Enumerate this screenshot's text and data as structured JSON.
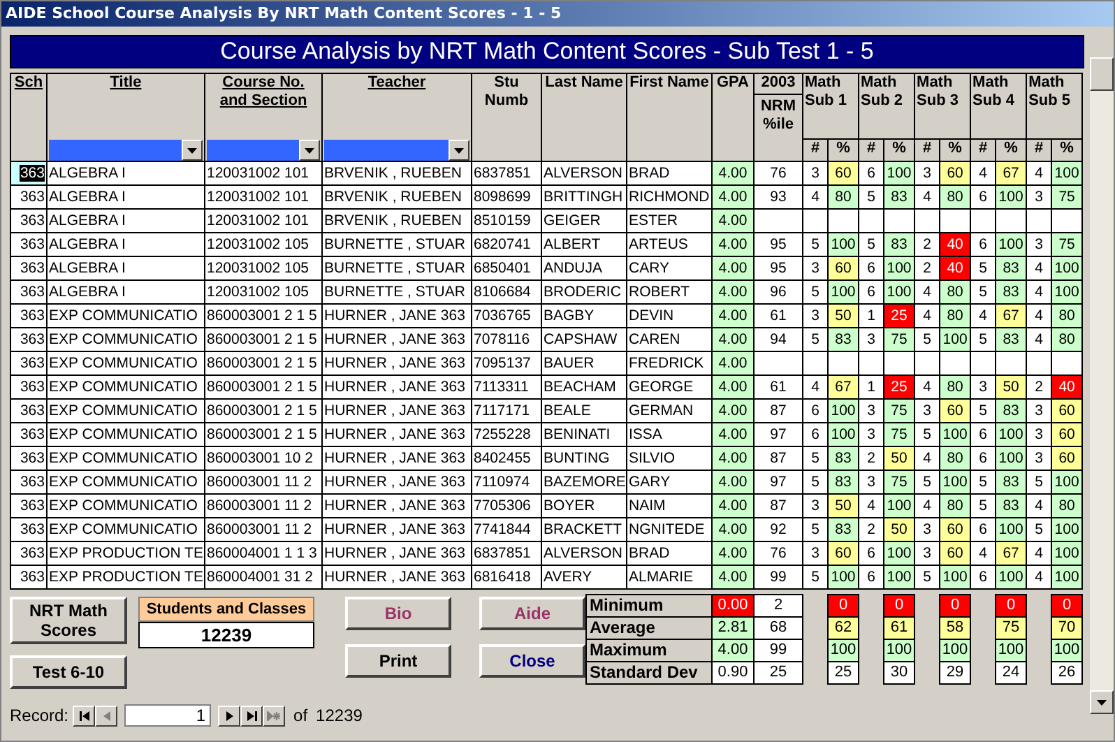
{
  "window": {
    "title": "AIDE School Course Analysis By NRT Math Content Scores - 1 - 5"
  },
  "banner": "Course Analysis by NRT Math Content Scores - Sub Test 1 - 5",
  "columns": {
    "sch": "Sch",
    "title": "Title",
    "course": "Course No. and Section",
    "teacher": "Teacher",
    "stu": "Stu Numb",
    "last": "Last Name",
    "first": "First Name",
    "gpa": "GPA",
    "year": "2003",
    "nrm": "NRM %ile",
    "subs": [
      "Math Sub 1",
      "Math Sub 2",
      "Math Sub 3",
      "Math Sub 4",
      "Math Sub 5"
    ],
    "count": "#",
    "pct": "%"
  },
  "rows": [
    {
      "selected": true,
      "sch": "363",
      "title": "ALGEBRA I",
      "course": "120031002 101",
      "teacher": "BRVENIK , RUEBEN",
      "stu": "6837851",
      "last": "ALVERSON",
      "first": "BRAD",
      "gpa": {
        "text": "4.00",
        "color": "#ccffcc"
      },
      "nrm": "76",
      "subs": [
        {
          "n": "3",
          "pct": "60",
          "color": "#ffff99"
        },
        {
          "n": "6",
          "pct": "100",
          "color": "#ccffcc"
        },
        {
          "n": "3",
          "pct": "60",
          "color": "#ffff99"
        },
        {
          "n": "4",
          "pct": "67",
          "color": "#ffff99"
        },
        {
          "n": "4",
          "pct": "100",
          "color": "#ccffcc"
        }
      ]
    },
    {
      "selected": false,
      "sch": "363",
      "title": "ALGEBRA I",
      "course": "120031002 101",
      "teacher": "BRVENIK , RUEBEN",
      "stu": "8098699",
      "last": "BRITTINGH",
      "first": "RICHMOND",
      "gpa": {
        "text": "4.00",
        "color": "#ccffcc"
      },
      "nrm": "93",
      "subs": [
        {
          "n": "4",
          "pct": "80",
          "color": "#ccffcc"
        },
        {
          "n": "5",
          "pct": "83",
          "color": "#ccffcc"
        },
        {
          "n": "4",
          "pct": "80",
          "color": "#ccffcc"
        },
        {
          "n": "6",
          "pct": "100",
          "color": "#ccffcc"
        },
        {
          "n": "3",
          "pct": "75",
          "color": "#ccffcc"
        }
      ]
    },
    {
      "selected": false,
      "sch": "363",
      "title": "ALGEBRA I",
      "course": "120031002 101",
      "teacher": "BRVENIK , RUEBEN",
      "stu": "8510159",
      "last": "GEIGER",
      "first": "ESTER",
      "gpa": {
        "text": "4.00",
        "color": "#ccffcc"
      }
    },
    {
      "selected": false,
      "sch": "363",
      "title": "ALGEBRA I",
      "course": "120031002 105",
      "teacher": "BURNETTE , STUAR",
      "stu": "6820741",
      "last": "ALBERT",
      "first": "ARTEUS",
      "gpa": {
        "text": "4.00",
        "color": "#ccffcc"
      },
      "nrm": "95",
      "subs": [
        {
          "n": "5",
          "pct": "100",
          "color": "#ccffcc"
        },
        {
          "n": "5",
          "pct": "83",
          "color": "#ccffcc"
        },
        {
          "n": "2",
          "pct": "40",
          "color": "#ff0000"
        },
        {
          "n": "6",
          "pct": "100",
          "color": "#ccffcc"
        },
        {
          "n": "3",
          "pct": "75",
          "color": "#ccffcc"
        }
      ]
    },
    {
      "selected": false,
      "sch": "363",
      "title": "ALGEBRA I",
      "course": "120031002 105",
      "teacher": "BURNETTE , STUAR",
      "stu": "6850401",
      "last": "ANDUJA",
      "first": "CARY",
      "gpa": {
        "text": "4.00",
        "color": "#ccffcc"
      },
      "nrm": "95",
      "subs": [
        {
          "n": "3",
          "pct": "60",
          "color": "#ffff99"
        },
        {
          "n": "6",
          "pct": "100",
          "color": "#ccffcc"
        },
        {
          "n": "2",
          "pct": "40",
          "color": "#ff0000"
        },
        {
          "n": "5",
          "pct": "83",
          "color": "#ccffcc"
        },
        {
          "n": "4",
          "pct": "100",
          "color": "#ccffcc"
        }
      ]
    },
    {
      "selected": false,
      "sch": "363",
      "title": "ALGEBRA I",
      "course": "120031002 105",
      "teacher": "BURNETTE , STUAR",
      "stu": "8106684",
      "last": "BRODERIC",
      "first": "ROBERT",
      "gpa": {
        "text": "4.00",
        "color": "#ccffcc"
      },
      "nrm": "96",
      "subs": [
        {
          "n": "5",
          "pct": "100",
          "color": "#ccffcc"
        },
        {
          "n": "6",
          "pct": "100",
          "color": "#ccffcc"
        },
        {
          "n": "4",
          "pct": "80",
          "color": "#ccffcc"
        },
        {
          "n": "5",
          "pct": "83",
          "color": "#ccffcc"
        },
        {
          "n": "4",
          "pct": "100",
          "color": "#ccffcc"
        }
      ]
    },
    {
      "selected": false,
      "sch": "363",
      "title": "EXP COMMUNICATIO",
      "course": "860003001 2 1 5",
      "teacher": "HURNER , JANE 363",
      "stu": "7036765",
      "last": "BAGBY",
      "first": "DEVIN",
      "gpa": {
        "text": "4.00",
        "color": "#ccffcc"
      },
      "nrm": "61",
      "subs": [
        {
          "n": "3",
          "pct": "50",
          "color": "#ffff99"
        },
        {
          "n": "1",
          "pct": "25",
          "color": "#ff0000"
        },
        {
          "n": "4",
          "pct": "80",
          "color": "#ccffcc"
        },
        {
          "n": "4",
          "pct": "67",
          "color": "#ffff99"
        },
        {
          "n": "4",
          "pct": "80",
          "color": "#ccffcc"
        }
      ]
    },
    {
      "selected": false,
      "sch": "363",
      "title": "EXP COMMUNICATIO",
      "course": "860003001 2 1 5",
      "teacher": "HURNER , JANE 363",
      "stu": "7078116",
      "last": "CAPSHAW",
      "first": "CAREN",
      "gpa": {
        "text": "4.00",
        "color": "#ccffcc"
      },
      "nrm": "94",
      "subs": [
        {
          "n": "5",
          "pct": "83",
          "color": "#ccffcc"
        },
        {
          "n": "3",
          "pct": "75",
          "color": "#ccffcc"
        },
        {
          "n": "5",
          "pct": "100",
          "color": "#ccffcc"
        },
        {
          "n": "5",
          "pct": "83",
          "color": "#ccffcc"
        },
        {
          "n": "4",
          "pct": "80",
          "color": "#ccffcc"
        }
      ]
    },
    {
      "selected": false,
      "sch": "363",
      "title": "EXP COMMUNICATIO",
      "course": "860003001 2 1 5",
      "teacher": "HURNER , JANE 363",
      "stu": "7095137",
      "last": "BAUER",
      "first": "FREDRICK",
      "gpa": {
        "text": "4.00",
        "color": "#ccffcc"
      }
    },
    {
      "selected": false,
      "sch": "363",
      "title": "EXP COMMUNICATIO",
      "course": "860003001 2 1 5",
      "teacher": "HURNER , JANE 363",
      "stu": "7113311",
      "last": "BEACHAM",
      "first": "GEORGE",
      "gpa": {
        "text": "4.00",
        "color": "#ccffcc"
      },
      "nrm": "61",
      "subs": [
        {
          "n": "4",
          "pct": "67",
          "color": "#ffff99"
        },
        {
          "n": "1",
          "pct": "25",
          "color": "#ff0000"
        },
        {
          "n": "4",
          "pct": "80",
          "color": "#ccffcc"
        },
        {
          "n": "3",
          "pct": "50",
          "color": "#ffff99"
        },
        {
          "n": "2",
          "pct": "40",
          "color": "#ff0000"
        }
      ]
    },
    {
      "selected": false,
      "sch": "363",
      "title": "EXP COMMUNICATIO",
      "course": "860003001 2 1 5",
      "teacher": "HURNER , JANE 363",
      "stu": "7117171",
      "last": "BEALE",
      "first": "GERMAN",
      "gpa": {
        "text": "4.00",
        "color": "#ccffcc"
      },
      "nrm": "87",
      "subs": [
        {
          "n": "6",
          "pct": "100",
          "color": "#ccffcc"
        },
        {
          "n": "3",
          "pct": "75",
          "color": "#ccffcc"
        },
        {
          "n": "3",
          "pct": "60",
          "color": "#ffff99"
        },
        {
          "n": "5",
          "pct": "83",
          "color": "#ccffcc"
        },
        {
          "n": "3",
          "pct": "60",
          "color": "#ffff99"
        }
      ]
    },
    {
      "selected": false,
      "sch": "363",
      "title": "EXP COMMUNICATIO",
      "course": "860003001 2 1 5",
      "teacher": "HURNER , JANE 363",
      "stu": "7255228",
      "last": "BENINATI",
      "first": "ISSA",
      "gpa": {
        "text": "4.00",
        "color": "#ccffcc"
      },
      "nrm": "97",
      "subs": [
        {
          "n": "6",
          "pct": "100",
          "color": "#ccffcc"
        },
        {
          "n": "3",
          "pct": "75",
          "color": "#ccffcc"
        },
        {
          "n": "5",
          "pct": "100",
          "color": "#ccffcc"
        },
        {
          "n": "6",
          "pct": "100",
          "color": "#ccffcc"
        },
        {
          "n": "3",
          "pct": "60",
          "color": "#ffff99"
        }
      ]
    },
    {
      "selected": false,
      "sch": "363",
      "title": "EXP COMMUNICATIO",
      "course": "860003001 10 2",
      "teacher": "HURNER , JANE 363",
      "stu": "8402455",
      "last": "BUNTING",
      "first": "SILVIO",
      "gpa": {
        "text": "4.00",
        "color": "#ccffcc"
      },
      "nrm": "87",
      "subs": [
        {
          "n": "5",
          "pct": "83",
          "color": "#ccffcc"
        },
        {
          "n": "2",
          "pct": "50",
          "color": "#ffff99"
        },
        {
          "n": "4",
          "pct": "80",
          "color": "#ccffcc"
        },
        {
          "n": "6",
          "pct": "100",
          "color": "#ccffcc"
        },
        {
          "n": "3",
          "pct": "60",
          "color": "#ffff99"
        }
      ]
    },
    {
      "selected": false,
      "sch": "363",
      "title": "EXP COMMUNICATIO",
      "course": "860003001 11 2",
      "teacher": "HURNER , JANE 363",
      "stu": "7110974",
      "last": "BAZEMORE",
      "first": "GARY",
      "gpa": {
        "text": "4.00",
        "color": "#ccffcc"
      },
      "nrm": "97",
      "subs": [
        {
          "n": "5",
          "pct": "83",
          "color": "#ccffcc"
        },
        {
          "n": "3",
          "pct": "75",
          "color": "#ccffcc"
        },
        {
          "n": "5",
          "pct": "100",
          "color": "#ccffcc"
        },
        {
          "n": "5",
          "pct": "83",
          "color": "#ccffcc"
        },
        {
          "n": "5",
          "pct": "100",
          "color": "#ccffcc"
        }
      ]
    },
    {
      "selected": false,
      "sch": "363",
      "title": "EXP COMMUNICATIO",
      "course": "860003001 11 2",
      "teacher": "HURNER , JANE 363",
      "stu": "7705306",
      "last": "BOYER",
      "first": "NAIM",
      "gpa": {
        "text": "4.00",
        "color": "#ccffcc"
      },
      "nrm": "87",
      "subs": [
        {
          "n": "3",
          "pct": "50",
          "color": "#ffff99"
        },
        {
          "n": "4",
          "pct": "100",
          "color": "#ccffcc"
        },
        {
          "n": "4",
          "pct": "80",
          "color": "#ccffcc"
        },
        {
          "n": "5",
          "pct": "83",
          "color": "#ccffcc"
        },
        {
          "n": "4",
          "pct": "80",
          "color": "#ccffcc"
        }
      ]
    },
    {
      "selected": false,
      "sch": "363",
      "title": "EXP COMMUNICATIO",
      "course": "860003001 11 2",
      "teacher": "HURNER , JANE 363",
      "stu": "7741844",
      "last": "BRACKETT",
      "first": "NGNITEDE",
      "gpa": {
        "text": "4.00",
        "color": "#ccffcc"
      },
      "nrm": "92",
      "subs": [
        {
          "n": "5",
          "pct": "83",
          "color": "#ccffcc"
        },
        {
          "n": "2",
          "pct": "50",
          "color": "#ffff99"
        },
        {
          "n": "3",
          "pct": "60",
          "color": "#ffff99"
        },
        {
          "n": "6",
          "pct": "100",
          "color": "#ccffcc"
        },
        {
          "n": "5",
          "pct": "100",
          "color": "#ccffcc"
        }
      ]
    },
    {
      "selected": false,
      "sch": "363",
      "title": "EXP PRODUCTION TE",
      "course": "860004001 1 1 3",
      "teacher": "HURNER , JANE 363",
      "stu": "6837851",
      "last": "ALVERSON",
      "first": "BRAD",
      "gpa": {
        "text": "4.00",
        "color": "#ccffcc"
      },
      "nrm": "76",
      "subs": [
        {
          "n": "3",
          "pct": "60",
          "color": "#ffff99"
        },
        {
          "n": "6",
          "pct": "100",
          "color": "#ccffcc"
        },
        {
          "n": "3",
          "pct": "60",
          "color": "#ffff99"
        },
        {
          "n": "4",
          "pct": "67",
          "color": "#ffff99"
        },
        {
          "n": "4",
          "pct": "100",
          "color": "#ccffcc"
        }
      ]
    },
    {
      "selected": false,
      "sch": "363",
      "title": "EXP PRODUCTION TE",
      "course": "860004001 31 2",
      "teacher": "HURNER , JANE 363",
      "stu": "6816418",
      "last": "AVERY",
      "first": "ALMARIE",
      "gpa": {
        "text": "4.00",
        "color": "#ccffcc"
      },
      "nrm": "99",
      "subs": [
        {
          "n": "5",
          "pct": "100",
          "color": "#ccffcc"
        },
        {
          "n": "6",
          "pct": "100",
          "color": "#ccffcc"
        },
        {
          "n": "5",
          "pct": "100",
          "color": "#ccffcc"
        },
        {
          "n": "6",
          "pct": "100",
          "color": "#ccffcc"
        },
        {
          "n": "4",
          "pct": "100",
          "color": "#ccffcc"
        }
      ]
    }
  ],
  "buttons": [
    {
      "label": "NRT Math Scores",
      "kind": "normal"
    },
    {
      "label": "Test 6-10",
      "kind": "normal"
    },
    {
      "label": "Bio",
      "kind": "maroon"
    },
    {
      "label": "Aide",
      "kind": "maroon"
    },
    {
      "label": "Print",
      "kind": "normal"
    },
    {
      "label": "Close",
      "kind": "navy"
    }
  ],
  "students_and_classes": {
    "label": "Students and Classes",
    "value": "12239"
  },
  "stats": [
    {
      "label": "Minimum",
      "gpa": {
        "text": "0.00",
        "color": "#ff0000"
      },
      "nrm": "2",
      "subs": [
        {
          "text": "0",
          "color": "#ff0000"
        },
        {
          "text": "0",
          "color": "#ff0000"
        },
        {
          "text": "0",
          "color": "#ff0000"
        },
        {
          "text": "0",
          "color": "#ff0000"
        },
        {
          "text": "0",
          "color": "#ff0000"
        }
      ]
    },
    {
      "label": "Average",
      "gpa": {
        "text": "2.81",
        "color": "#ccffcc"
      },
      "nrm": "68",
      "subs": [
        {
          "text": "62",
          "color": "#ffff99"
        },
        {
          "text": "61",
          "color": "#ffff99"
        },
        {
          "text": "58",
          "color": "#ffff99"
        },
        {
          "text": "75",
          "color": "#ffff99"
        },
        {
          "text": "70",
          "color": "#ffff99"
        }
      ]
    },
    {
      "label": "Maximum",
      "gpa": {
        "text": "4.00",
        "color": "#ccffcc"
      },
      "nrm": "99",
      "subs": [
        {
          "text": "100",
          "color": "#ccffcc"
        },
        {
          "text": "100",
          "color": "#ccffcc"
        },
        {
          "text": "100",
          "color": "#ccffcc"
        },
        {
          "text": "100",
          "color": "#ccffcc"
        },
        {
          "text": "100",
          "color": "#ccffcc"
        }
      ]
    },
    {
      "label": "Standard Dev",
      "gpa": {
        "text": "0.90",
        "color": "#ffffff"
      },
      "nrm": "25",
      "subs": [
        {
          "text": "25",
          "color": "#ffffff"
        },
        {
          "text": "30",
          "color": "#ffffff"
        },
        {
          "text": "29",
          "color": "#ffffff"
        },
        {
          "text": "24",
          "color": "#ffffff"
        },
        {
          "text": "26",
          "color": "#ffffff"
        }
      ]
    }
  ],
  "record_nav": {
    "label": "Record:",
    "current": "1",
    "of": "of",
    "total": "12239"
  }
}
